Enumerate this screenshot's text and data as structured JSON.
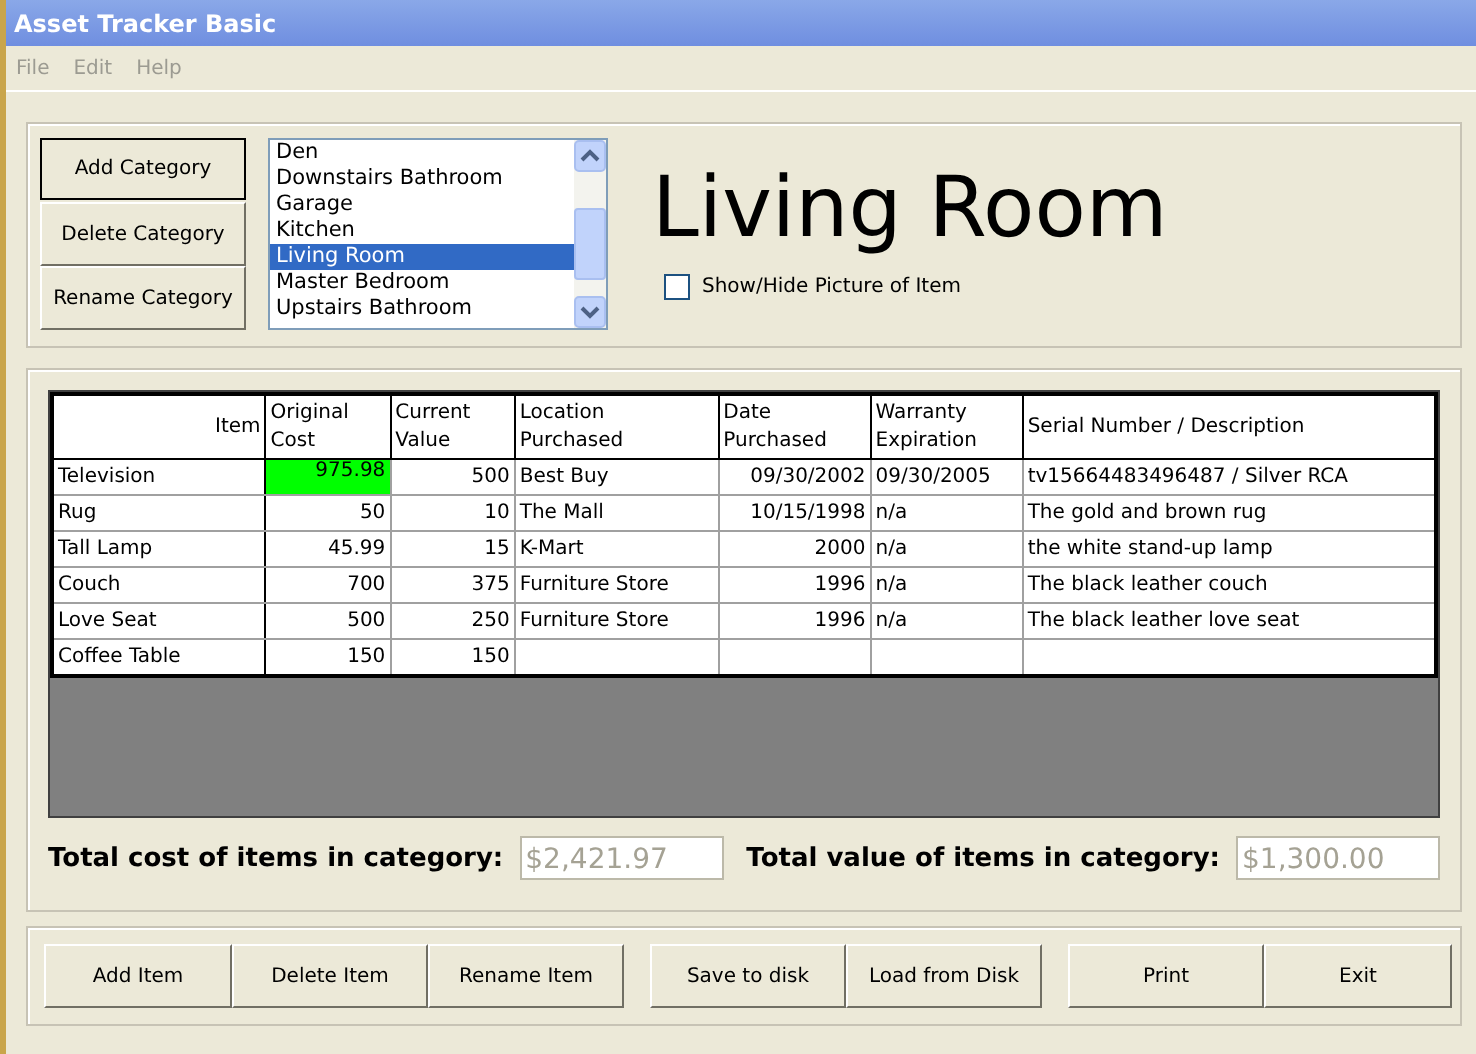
{
  "window": {
    "title": "Asset Tracker Basic"
  },
  "menu": [
    "File",
    "Edit",
    "Help"
  ],
  "category_buttons": [
    "Add Category",
    "Delete Category",
    "Rename Category"
  ],
  "categories": [
    {
      "label": "Den",
      "selected": false
    },
    {
      "label": "Downstairs Bathroom",
      "selected": false
    },
    {
      "label": "Garage",
      "selected": false
    },
    {
      "label": "Kitchen",
      "selected": false
    },
    {
      "label": "Living Room",
      "selected": true
    },
    {
      "label": "Master Bedroom",
      "selected": false
    },
    {
      "label": "Upstairs Bathroom",
      "selected": false
    }
  ],
  "category_title": "Living Room",
  "picture_toggle": {
    "label": "Show/Hide Picture of Item",
    "checked": false
  },
  "table": {
    "columns": [
      "Item",
      "Original Cost",
      "Current Value",
      "Location Purchased",
      "Date Purchased",
      "Warranty Expiration",
      "Serial Number / Description"
    ],
    "rows": [
      {
        "cells": [
          {
            "text": "Television",
            "selected": false
          },
          {
            "text": "975.98",
            "selected": true
          },
          {
            "text": "500",
            "selected": false
          },
          {
            "text": "Best Buy",
            "selected": false
          },
          {
            "text": "09/30/2002",
            "selected": false
          },
          {
            "text": "09/30/2005",
            "selected": false
          },
          {
            "text": "tv15664483496487 / Silver RCA",
            "selected": false
          }
        ]
      },
      {
        "cells": [
          {
            "text": "Rug",
            "selected": false
          },
          {
            "text": "50",
            "selected": false
          },
          {
            "text": "10",
            "selected": false
          },
          {
            "text": "The Mall",
            "selected": false
          },
          {
            "text": "10/15/1998",
            "selected": false
          },
          {
            "text": "n/a",
            "selected": false
          },
          {
            "text": "The gold and brown rug",
            "selected": false
          }
        ]
      },
      {
        "cells": [
          {
            "text": "Tall Lamp",
            "selected": false
          },
          {
            "text": "45.99",
            "selected": false
          },
          {
            "text": "15",
            "selected": false
          },
          {
            "text": "K-Mart",
            "selected": false
          },
          {
            "text": "2000",
            "selected": false
          },
          {
            "text": "n/a",
            "selected": false
          },
          {
            "text": "the white stand-up lamp",
            "selected": false
          }
        ]
      },
      {
        "cells": [
          {
            "text": "Couch",
            "selected": false
          },
          {
            "text": "700",
            "selected": false
          },
          {
            "text": "375",
            "selected": false
          },
          {
            "text": "Furniture Store",
            "selected": false
          },
          {
            "text": "1996",
            "selected": false
          },
          {
            "text": "n/a",
            "selected": false
          },
          {
            "text": "The black leather couch",
            "selected": false
          }
        ]
      },
      {
        "cells": [
          {
            "text": "Love Seat",
            "selected": false
          },
          {
            "text": "500",
            "selected": false
          },
          {
            "text": "250",
            "selected": false
          },
          {
            "text": "Furniture Store",
            "selected": false
          },
          {
            "text": "1996",
            "selected": false
          },
          {
            "text": "n/a",
            "selected": false
          },
          {
            "text": "The black leather love seat",
            "selected": false
          }
        ]
      },
      {
        "cells": [
          {
            "text": "Coffee Table",
            "selected": false
          },
          {
            "text": "150",
            "selected": false
          },
          {
            "text": "150",
            "selected": false
          }
        ]
      }
    ]
  },
  "totals": [
    {
      "label": "Total cost of items in category:",
      "value": "$2,421.97"
    },
    {
      "label": "Total value of items in category:",
      "value": "$1,300.00"
    }
  ],
  "button_groups": [
    [
      "Add Item",
      "Delete Item",
      "Rename Item"
    ],
    [
      "Save to disk",
      "Load from Disk"
    ],
    [
      "Print",
      "Exit"
    ]
  ]
}
